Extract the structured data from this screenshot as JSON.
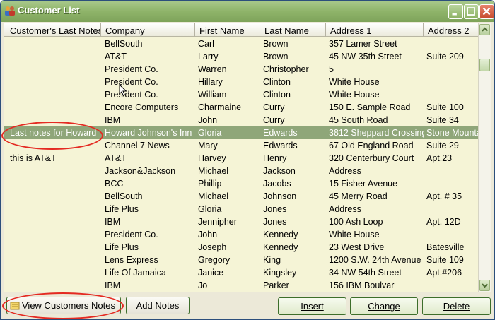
{
  "window": {
    "title": "Customer List",
    "icon": "people-icon",
    "controls": [
      "minimize-icon",
      "maximize-icon",
      "close-icon"
    ]
  },
  "colors": {
    "titlebar": "#8fb46a",
    "grid_background": "#f5f4d6",
    "selected_row": "#8fa679",
    "annotation": "#e42a22"
  },
  "grid": {
    "columns": [
      "Customer's Last Notes",
      "Company",
      "First Name",
      "Last Name",
      "Address 1",
      "Address 2"
    ],
    "rows": [
      {
        "notes": "",
        "company": "BellSouth",
        "first": "Carl",
        "last": "Brown",
        "addr1": "357 Lamer Street",
        "addr2": ""
      },
      {
        "notes": "",
        "company": "AT&T",
        "first": "Larry",
        "last": "Brown",
        "addr1": "45 NW 35th Street",
        "addr2": "Suite 209"
      },
      {
        "notes": "",
        "company": "President Co.",
        "first": "Warren",
        "last": "Christopher",
        "addr1": "5",
        "addr2": ""
      },
      {
        "notes": "",
        "company": "President Co.",
        "first": "Hillary",
        "last": "Clinton",
        "addr1": "White House",
        "addr2": ""
      },
      {
        "notes": "",
        "company": "President Co.",
        "first": "William",
        "last": "Clinton",
        "addr1": "White House",
        "addr2": ""
      },
      {
        "notes": "",
        "company": "Encore Computers",
        "first": "Charmaine",
        "last": "Curry",
        "addr1": "150 E. Sample Road",
        "addr2": "Suite 100"
      },
      {
        "notes": "",
        "company": "IBM",
        "first": "John",
        "last": "Curry",
        "addr1": "45 South Road",
        "addr2": "Suite 34"
      },
      {
        "notes": "Last notes for Howard",
        "company": "Howard Johnson's Inn",
        "first": "Gloria",
        "last": "Edwards",
        "addr1": "3812 Sheppard Crossing",
        "addr2": "Stone Mounta"
      },
      {
        "notes": "",
        "company": "Channel 7 News",
        "first": "Mary",
        "last": "Edwards",
        "addr1": "67 Old England Road",
        "addr2": "Suite 29"
      },
      {
        "notes": "this is AT&T",
        "company": "AT&T",
        "first": "Harvey",
        "last": "Henry",
        "addr1": "320 Centerbury Court",
        "addr2": "Apt.23"
      },
      {
        "notes": "",
        "company": "Jackson&Jackson",
        "first": "Michael",
        "last": "Jackson",
        "addr1": "Address",
        "addr2": ""
      },
      {
        "notes": "",
        "company": "BCC",
        "first": "Phillip",
        "last": "Jacobs",
        "addr1": "15 Fisher Avenue",
        "addr2": ""
      },
      {
        "notes": "",
        "company": "BellSouth",
        "first": "Michael",
        "last": "Johnson",
        "addr1": "45 Merry Road",
        "addr2": "Apt. # 35"
      },
      {
        "notes": "",
        "company": "Life Plus",
        "first": "Gloria",
        "last": "Jones",
        "addr1": "Address",
        "addr2": ""
      },
      {
        "notes": "",
        "company": "IBM",
        "first": "Jennipher",
        "last": "Jones",
        "addr1": "100 Ash Loop",
        "addr2": "Apt. 12D"
      },
      {
        "notes": "",
        "company": "President Co.",
        "first": "John",
        "last": "Kennedy",
        "addr1": "White House",
        "addr2": ""
      },
      {
        "notes": "",
        "company": "Life Plus",
        "first": "Joseph",
        "last": "Kennedy",
        "addr1": "23 West Drive",
        "addr2": "Batesville"
      },
      {
        "notes": "",
        "company": "Lens Express",
        "first": "Gregory",
        "last": "King",
        "addr1": "1200 S.W. 24th Avenue",
        "addr2": "Suite 109"
      },
      {
        "notes": "",
        "company": "Life Of Jamaica",
        "first": "Janice",
        "last": "Kingsley",
        "addr1": "34 NW 54th Street",
        "addr2": "Apt.#206"
      },
      {
        "notes": "",
        "company": "IBM",
        "first": "Jo",
        "last": "Parker",
        "addr1": "156 IBM Boulvar",
        "addr2": ""
      }
    ],
    "selected_index": 7
  },
  "buttons": {
    "view_notes": "View Customers Notes",
    "view_notes_icon": "notes-icon",
    "add_notes": "Add Notes",
    "insert": "Insert",
    "change": "Change",
    "delete": "Delete"
  }
}
